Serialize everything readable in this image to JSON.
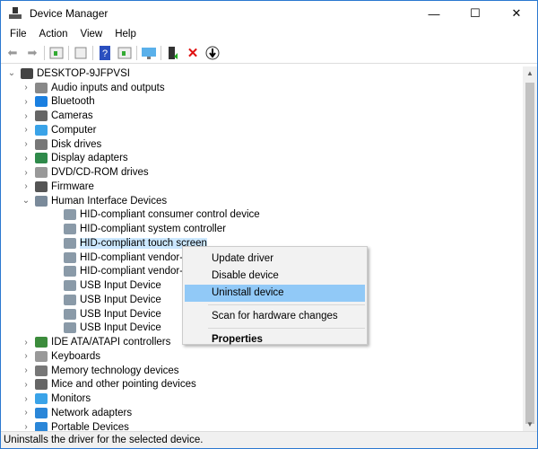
{
  "window": {
    "title": "Device Manager",
    "controls": [
      "minimize",
      "maximize",
      "close"
    ]
  },
  "menu": [
    "File",
    "Action",
    "View",
    "Help"
  ],
  "toolbar": [
    "back-icon",
    "forward-icon",
    "show-hide-console-tree-icon",
    "properties-icon",
    "help-icon",
    "action-pane-icon",
    "scan-monitor-icon",
    "update-driver-icon",
    "uninstall-x-icon",
    "disable-down-icon"
  ],
  "tree": {
    "root": "DESKTOP-9JFPVSI",
    "categories": [
      {
        "label": "Audio inputs and outputs",
        "color": "#888"
      },
      {
        "label": "Bluetooth",
        "color": "#1a7fe0"
      },
      {
        "label": "Cameras",
        "color": "#666"
      },
      {
        "label": "Computer",
        "color": "#3aa3e8"
      },
      {
        "label": "Disk drives",
        "color": "#777"
      },
      {
        "label": "Display adapters",
        "color": "#2f8a4a"
      },
      {
        "label": "DVD/CD-ROM drives",
        "color": "#999"
      },
      {
        "label": "Firmware",
        "color": "#555"
      },
      {
        "label": "Human Interface Devices",
        "color": "#7a8a9a",
        "expanded": true,
        "children": [
          "HID-compliant consumer control device",
          "HID-compliant system controller",
          "HID-compliant touch screen",
          "HID-compliant vendor-defir",
          "HID-compliant vendor-defir",
          "USB Input Device",
          "USB Input Device",
          "USB Input Device",
          "USB Input Device"
        ]
      },
      {
        "label": "IDE ATA/ATAPI controllers",
        "color": "#3c8c3c"
      },
      {
        "label": "Keyboards",
        "color": "#999"
      },
      {
        "label": "Memory technology devices",
        "color": "#777"
      },
      {
        "label": "Mice and other pointing devices",
        "color": "#666"
      },
      {
        "label": "Monitors",
        "color": "#3aa3e8"
      },
      {
        "label": "Network adapters",
        "color": "#2a86d8"
      },
      {
        "label": "Portable Devices",
        "color": "#2a86d8"
      }
    ],
    "selected": "HID-compliant touch screen"
  },
  "context_menu": {
    "items": [
      "Update driver",
      "Disable device",
      "Uninstall device",
      "Scan for hardware changes",
      "Properties"
    ],
    "highlighted": "Uninstall device"
  },
  "status": "Uninstalls the driver for the selected device."
}
